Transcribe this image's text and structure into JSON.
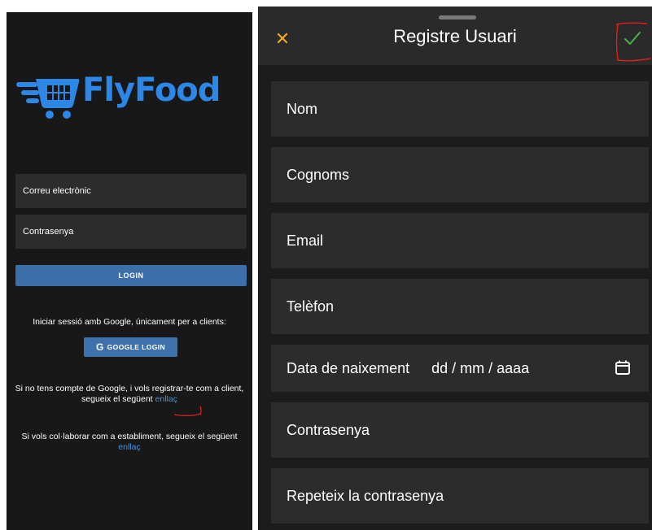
{
  "login": {
    "logo_text": "FlyFood",
    "email_placeholder": "Correu electrònic",
    "password_placeholder": "Contrasenya",
    "login_button": "LOGIN",
    "google_prompt": "Iniciar sessió amb Google, únicament per a clients:",
    "google_button": "GOOGLE LOGIN",
    "google_icon_glyph": "G",
    "register_text": "Si no tens compte de Google, i vols registrar-te com a client, segueix el següent",
    "register_link": "enllaç",
    "establishment_text": "Si vols col·laborar com a establiment, segueix el següent",
    "establishment_link": "enllaç"
  },
  "register": {
    "title": "Registre Usuari",
    "close_glyph": "✕",
    "fields": {
      "name": "Nom",
      "surname": "Cognoms",
      "email": "Email",
      "phone": "Telèfon",
      "birthdate_label": "Data de naixement",
      "birthdate_value": "dd / mm / aaaa",
      "password": "Contrasenya",
      "repeat_password": "Repeteix la contrasenya"
    }
  },
  "colors": {
    "brand": "#2c87e6",
    "accent_close": "#f0a91f",
    "accent_check": "#4caf50",
    "annotation": "#e02020"
  }
}
